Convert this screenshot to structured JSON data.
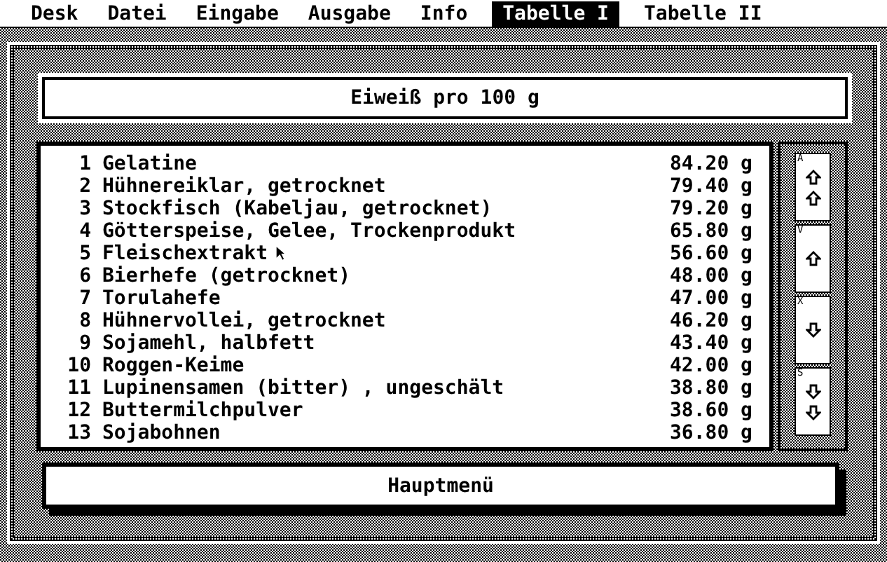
{
  "menu_bar": [
    {
      "label": "Desk",
      "selected": false
    },
    {
      "label": "Datei",
      "selected": false
    },
    {
      "label": "Eingabe",
      "selected": false
    },
    {
      "label": "Ausgabe",
      "selected": false
    },
    {
      "label": "Info",
      "selected": false
    },
    {
      "label": "Tabelle I",
      "selected": true
    },
    {
      "label": "Tabelle II",
      "selected": false
    }
  ],
  "dialog": {
    "title": "Eiweiß pro 100 g",
    "rows": [
      {
        "rank": "1",
        "name": "Gelatine",
        "value": "84.20 g"
      },
      {
        "rank": "2",
        "name": "Hühnereiklar, getrocknet",
        "value": "79.40 g"
      },
      {
        "rank": "3",
        "name": "Stockfisch (Kabeljau, getrocknet)",
        "value": "79.20 g"
      },
      {
        "rank": "4",
        "name": "Götterspeise, Gelee, Trockenprodukt",
        "value": "65.80 g"
      },
      {
        "rank": "5",
        "name": "Fleischextrakt",
        "value": "56.60 g"
      },
      {
        "rank": "6",
        "name": "Bierhefe (getrocknet)",
        "value": "48.00 g"
      },
      {
        "rank": "7",
        "name": "Torulahefe",
        "value": "47.00 g"
      },
      {
        "rank": "8",
        "name": "Hühnervollei, getrocknet",
        "value": "46.20 g"
      },
      {
        "rank": "9",
        "name": "Sojamehl, halbfett",
        "value": "43.40 g"
      },
      {
        "rank": "10",
        "name": "Roggen-Keime",
        "value": "42.00 g"
      },
      {
        "rank": "11",
        "name": "Lupinensamen (bitter) , ungeschält",
        "value": "38.80 g"
      },
      {
        "rank": "12",
        "name": "Buttermilchpulver",
        "value": "38.60 g"
      },
      {
        "rank": "13",
        "name": "Sojabohnen",
        "value": "36.80 g"
      }
    ],
    "scroll_buttons": [
      {
        "key": "A",
        "kind": "page-up"
      },
      {
        "key": "V",
        "kind": "up"
      },
      {
        "key": "X",
        "kind": "down"
      },
      {
        "key": "S",
        "kind": "page-down"
      }
    ],
    "button": "Hauptmenü"
  }
}
